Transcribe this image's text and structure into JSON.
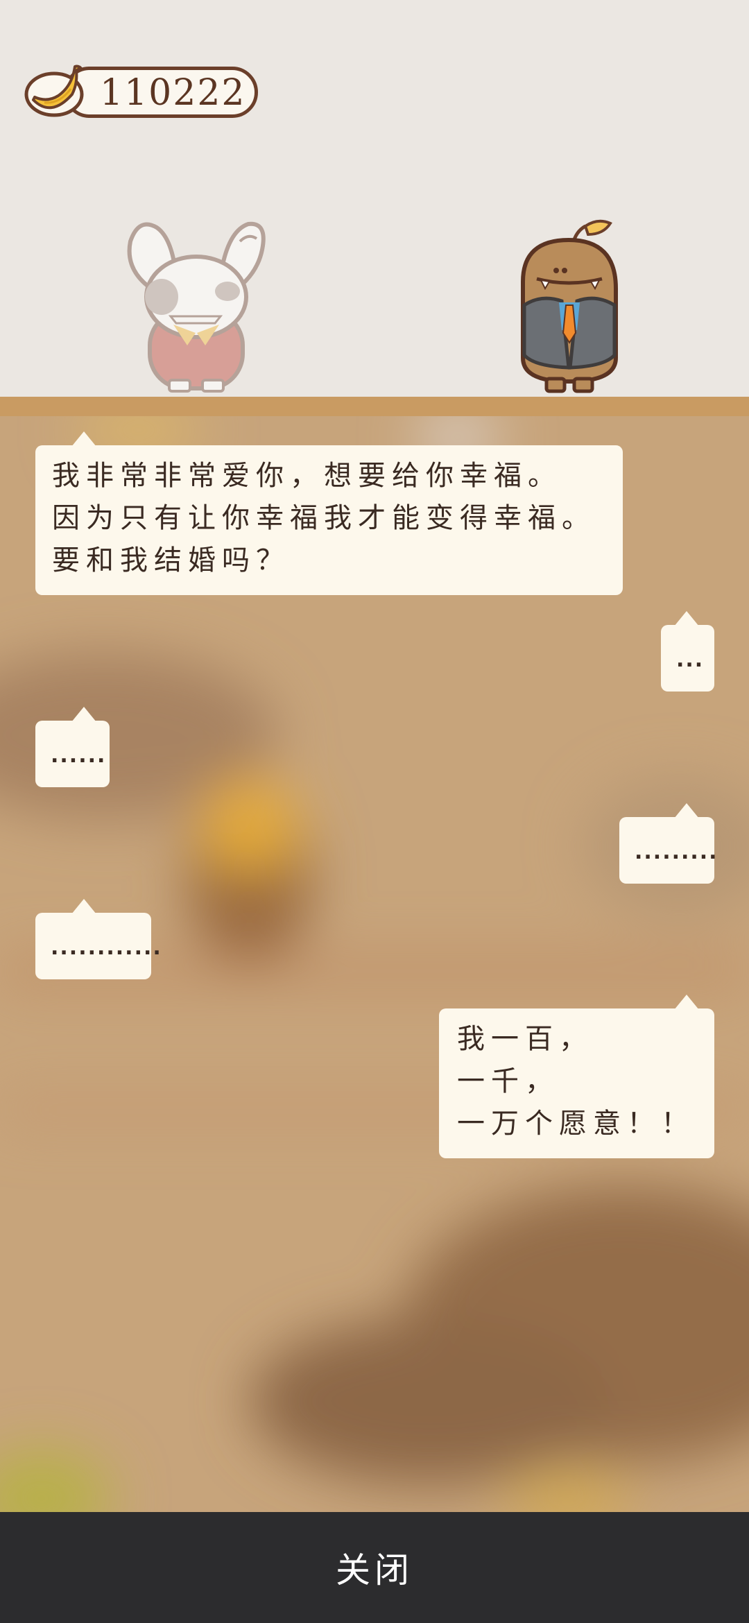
{
  "header": {
    "banana_count": "110222",
    "banana_icon": "banana-icon"
  },
  "characters": {
    "left": "rabbit-character-icon",
    "right": "potato-groom-character-icon"
  },
  "messages": [
    {
      "side": "left",
      "lines": [
        "我非常非常爱你，想要给你幸福。",
        "因为只有让你幸福我才能变得幸福。",
        "要和我结婚吗？"
      ]
    },
    {
      "side": "right",
      "text": "..."
    },
    {
      "side": "left",
      "text": "......"
    },
    {
      "side": "right",
      "text": "........."
    },
    {
      "side": "left",
      "text": "............"
    },
    {
      "side": "right",
      "lines": [
        "我一百，",
        "一千，",
        "一万个愿意！！"
      ]
    }
  ],
  "footer": {
    "close_label": "关闭"
  },
  "colors": {
    "stage_bg": "#ebe7e2",
    "floor": "#c99b62",
    "chat_bg": "#c7a47b",
    "bubble": "#fdf8ec",
    "bottom_bar": "#2c2c2e"
  }
}
